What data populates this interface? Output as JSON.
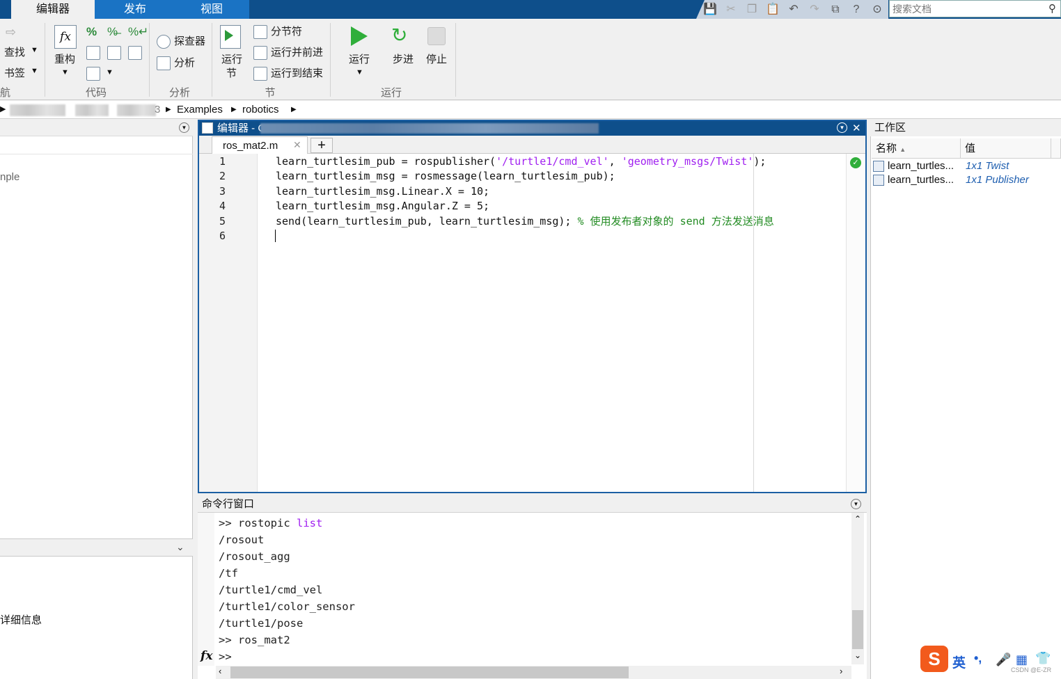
{
  "tabs": [
    {
      "label": "编辑器",
      "active": true
    },
    {
      "label": "发布",
      "active": false
    },
    {
      "label": "视图",
      "active": false
    }
  ],
  "search": {
    "placeholder": "搜索文档"
  },
  "ribbon": {
    "nav": {
      "find": "查找",
      "bookmark": "书签",
      "group": "航"
    },
    "code": {
      "refactor": "重构",
      "group": "代码",
      "percent": "%"
    },
    "analyze": {
      "explorer": "探查器",
      "analyze": "分析",
      "group": "分析"
    },
    "section": {
      "run_section": "运行\n节",
      "run_section_1": "运行",
      "run_section_2": "节",
      "breaker": "分节符",
      "run_advance": "运行并前进",
      "run_to_end": "运行到结束",
      "group": "节"
    },
    "run": {
      "run": "运行",
      "step": "步进",
      "stop": "停止",
      "group": "运行"
    }
  },
  "breadcrumb": {
    "items": [
      "3",
      "Examples",
      "robotics"
    ]
  },
  "left_panel": {
    "text1": "nple",
    "text2": "详细信息"
  },
  "editor": {
    "title": "编辑器 - C",
    "file_tab": "ros_mat2.m",
    "lines": [
      {
        "n": "1",
        "parts": [
          {
            "t": "learn_turtlesim_pub = rospublisher(",
            "c": ""
          },
          {
            "t": "'/turtle1/cmd_vel'",
            "c": "str"
          },
          {
            "t": ", ",
            "c": ""
          },
          {
            "t": "'geometry_msgs/Twist'",
            "c": "str"
          },
          {
            "t": ");",
            "c": ""
          }
        ]
      },
      {
        "n": "2",
        "parts": [
          {
            "t": "learn_turtlesim_msg = rosmessage(learn_turtlesim_pub);",
            "c": ""
          }
        ]
      },
      {
        "n": "3",
        "parts": [
          {
            "t": "learn_turtlesim_msg.Linear.X = 10;",
            "c": ""
          }
        ]
      },
      {
        "n": "4",
        "parts": [
          {
            "t": "learn_turtlesim_msg.Angular.Z = 5;",
            "c": ""
          }
        ]
      },
      {
        "n": "5",
        "parts": [
          {
            "t": "send(learn_turtlesim_pub, learn_turtlesim_msg); ",
            "c": ""
          },
          {
            "t": "% 使用发布者对象的 send 方法发送消息",
            "c": "cmt"
          }
        ]
      },
      {
        "n": "6",
        "parts": [
          {
            "t": "",
            "c": ""
          }
        ]
      }
    ]
  },
  "command_window": {
    "title": "命令行窗口",
    "lines": [
      {
        "prompt": ">> ",
        "text": "rostopic ",
        "kw": "list"
      },
      {
        "prompt": "",
        "text": "/rosout",
        "kw": ""
      },
      {
        "prompt": "",
        "text": "/rosout_agg",
        "kw": ""
      },
      {
        "prompt": "",
        "text": "/tf",
        "kw": ""
      },
      {
        "prompt": "",
        "text": "/turtle1/cmd_vel",
        "kw": ""
      },
      {
        "prompt": "",
        "text": "/turtle1/color_sensor",
        "kw": ""
      },
      {
        "prompt": "",
        "text": "/turtle1/pose",
        "kw": ""
      },
      {
        "prompt": ">> ",
        "text": "ros_mat2",
        "kw": ""
      },
      {
        "prompt": ">>",
        "text": "",
        "kw": ""
      }
    ],
    "fx": "fx"
  },
  "workspace": {
    "title": "工作区",
    "col_name": "名称",
    "col_value": "值",
    "rows": [
      {
        "name": "learn_turtles...",
        "value": "1x1 Twist"
      },
      {
        "name": "learn_turtles...",
        "value": "1x1 Publisher"
      }
    ]
  },
  "ime": {
    "lang": "英",
    "punct": "•,",
    "watermark": "CSDN @E-ZR"
  },
  "colors": {
    "title_bar": "#0e4f8b",
    "accent": "#1b5fa3",
    "string": "#a020f0",
    "comment": "#228b22"
  }
}
